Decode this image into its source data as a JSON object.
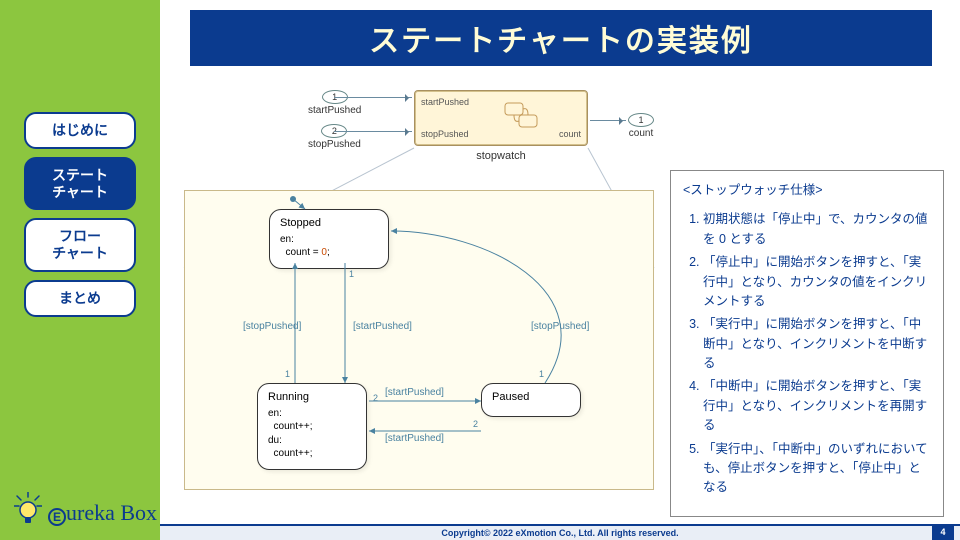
{
  "title": "ステートチャートの実装例",
  "nav": {
    "items": [
      {
        "label": "はじめに",
        "active": false
      },
      {
        "label": "ステート\nチャート",
        "active": true
      },
      {
        "label": "フロー\nチャート",
        "active": false
      },
      {
        "label": "まとめ",
        "active": false
      }
    ]
  },
  "logo": {
    "initial": "E",
    "text": "ureka Box"
  },
  "model": {
    "inputs": [
      {
        "num": "1",
        "label": "startPushed"
      },
      {
        "num": "2",
        "label": "stopPushed"
      }
    ],
    "outputs": [
      {
        "num": "1",
        "label": "count"
      }
    ],
    "block_ports": {
      "in1": "startPushed",
      "in2": "stopPushed",
      "out1": "count"
    },
    "block_label": "stopwatch"
  },
  "states": {
    "stopped": {
      "name": "Stopped",
      "body": "en:\n  count = 0;"
    },
    "running": {
      "name": "Running",
      "body": "en:\n  count++;\ndu:\n  count++;"
    },
    "paused": {
      "name": "Paused",
      "body": ""
    }
  },
  "transitions": {
    "t1": "[stopPushed]",
    "t2": "[startPushed]",
    "t3": "[startPushed]",
    "t4": "[startPushed]",
    "t5": "[stopPushed]"
  },
  "spec": {
    "title": "<ストップウォッチ仕様>",
    "items": [
      "初期状態は「停止中」で、カウンタの値を 0 とする",
      "「停止中」に開始ボタンを押すと、「実行中」となり、カウンタの値をインクリメントする",
      "「実行中」に開始ボタンを押すと、「中断中」となり、インクリメントを中断する",
      "「中断中」に開始ボタンを押すと、「実行中」となり、インクリメントを再開する",
      "「実行中」、「中断中」のいずれにおいても、停止ボタンを押すと、「停止中」となる"
    ]
  },
  "footer": {
    "copyright": "Copyright© 2022 eXmotion Co., Ltd. All rights reserved.",
    "page": "4"
  }
}
